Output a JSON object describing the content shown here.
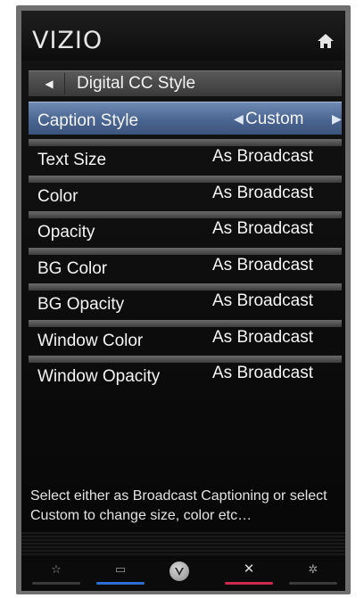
{
  "brand": "VIZIO",
  "breadcrumb": {
    "back_icon": "back-arrow-icon",
    "title": "Digital CC Style"
  },
  "menu": [
    {
      "label": "Caption Style",
      "value": "Custom",
      "selected": true
    },
    {
      "label": "Text Size",
      "value": "As Broadcast"
    },
    {
      "label": "Color",
      "value": "As Broadcast"
    },
    {
      "label": "Opacity",
      "value": "As Broadcast"
    },
    {
      "label": "BG Color",
      "value": "As Broadcast"
    },
    {
      "label": "BG Opacity",
      "value": "As Broadcast"
    },
    {
      "label": "Window Color",
      "value": "As Broadcast"
    },
    {
      "label": "Window Opacity",
      "value": "As Broadcast"
    }
  ],
  "help_text": "Select either as Broadcast Captioning or select Custom to change size, color etc…",
  "nav": {
    "icons": [
      "star-icon",
      "screen-icon",
      "vizio-v-icon",
      "close-icon",
      "gear-icon"
    ],
    "colors": {
      "screen_underline": "#2a6fd1",
      "close_underline": "#d12a4f",
      "selected_bg": "#4a6591"
    }
  }
}
